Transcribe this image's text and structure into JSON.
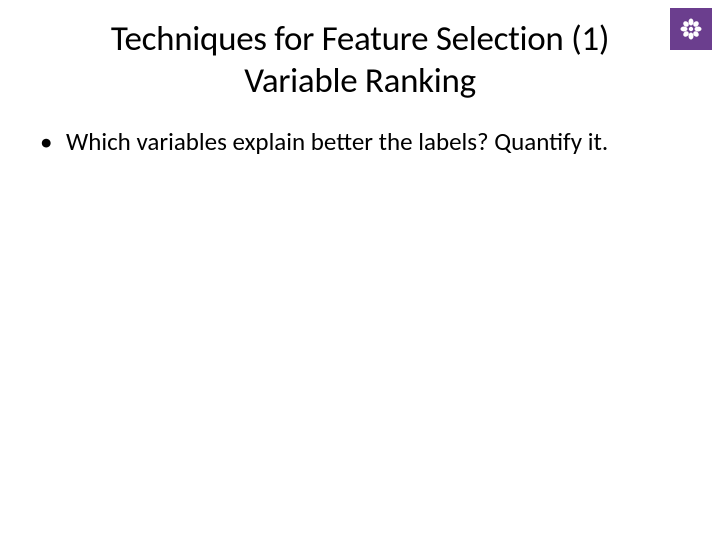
{
  "header": {
    "title_line1": "Techniques for Feature Selection (1)",
    "title_line2": "Variable Ranking"
  },
  "content": {
    "bullets": [
      {
        "marker": "•",
        "text": "Which variables explain better the labels? Quantify it."
      }
    ]
  },
  "logo": {
    "name": "institution-logo",
    "bg_color": "#6b3e8e"
  }
}
